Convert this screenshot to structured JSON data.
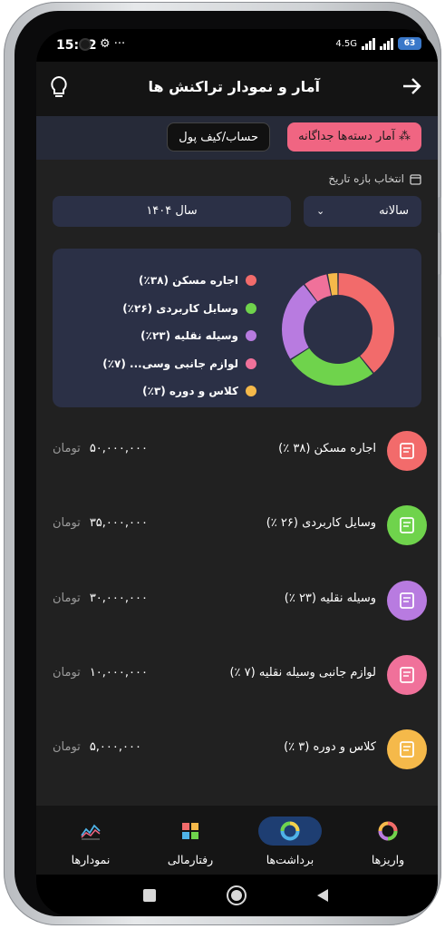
{
  "status_bar": {
    "time": "15:42",
    "network": "4.5G",
    "battery": "63"
  },
  "header": {
    "title": "آمار و نمودار تراکنش ها"
  },
  "tabs": {
    "active": "آمار دسته‌ها جداگانه",
    "inactive": "حساب/کیف پول"
  },
  "date_range": {
    "label": "انتخاب بازه تاریخ",
    "period_value": "سالانه",
    "year_value": "سال ۱۴۰۴"
  },
  "legend": [
    {
      "label": "اجاره مسکن (۳۸٪)",
      "color": "#f26b6b"
    },
    {
      "label": "وسایل کاربردی (۲۶٪)",
      "color": "#6fd34c"
    },
    {
      "label": "وسیله نقلیه (۲۳٪)",
      "color": "#b87be0"
    },
    {
      "label": "لوازم جانبی وسی... (۷٪)",
      "color": "#f0719a"
    },
    {
      "label": "کلاس و دوره (۳٪)",
      "color": "#f5b94a"
    }
  ],
  "chart_data": {
    "type": "pie",
    "categories": [
      "اجاره مسکن",
      "وسایل کاربردی",
      "وسیله نقلیه",
      "لوازم جانبی وسیله نقلیه",
      "کلاس و دوره"
    ],
    "values": [
      38,
      26,
      23,
      7,
      3
    ],
    "colors": [
      "#f26b6b",
      "#6fd34c",
      "#b87be0",
      "#f0719a",
      "#f5b94a"
    ]
  },
  "categories": [
    {
      "name": "اجاره مسکن (۳۸ ٪)",
      "amount": "۵۰,۰۰۰,۰۰۰",
      "currency": "تومان",
      "icon": "house-contract-icon",
      "color": "#f26b6b"
    },
    {
      "name": "وسایل کاربردی (۲۶ ٪)",
      "amount": "۳۵,۰۰۰,۰۰۰",
      "currency": "تومان",
      "icon": "office-chair-icon",
      "color": "#6fd34c"
    },
    {
      "name": "وسیله نقلیه (۲۳ ٪)",
      "amount": "۳۰,۰۰۰,۰۰۰",
      "currency": "تومان",
      "icon": "car-icon",
      "color": "#b87be0"
    },
    {
      "name": "لوازم جانبی وسیله نقلیه (۷ ٪)",
      "amount": "۱۰,۰۰۰,۰۰۰",
      "currency": "تومان",
      "icon": "helmet-icon",
      "color": "#f0719a"
    },
    {
      "name": "کلاس و دوره (۳ ٪)",
      "amount": "۵,۰۰۰,۰۰۰",
      "currency": "تومان",
      "icon": "video-course-icon",
      "color": "#f5b94a"
    }
  ],
  "bottom_nav": [
    {
      "label": "واریزها",
      "icon": "deposits-ring-icon"
    },
    {
      "label": "برداشت‌ها",
      "icon": "withdrawals-ring-icon"
    },
    {
      "label": "رفتارمالی",
      "icon": "grid-tiles-icon"
    },
    {
      "label": "نمودارها",
      "icon": "line-chart-icon"
    }
  ]
}
